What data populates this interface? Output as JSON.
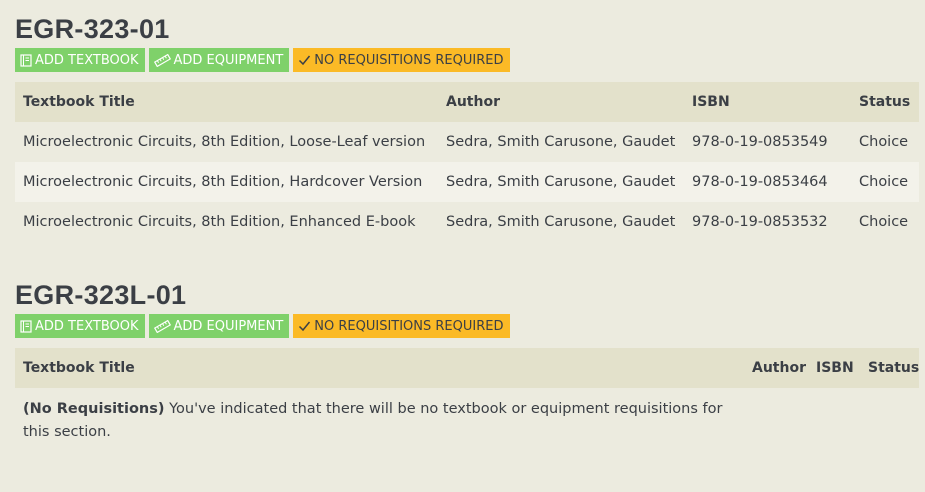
{
  "sections": [
    {
      "title": "EGR-323-01",
      "buttons": {
        "add_textbook": "ADD TEXTBOOK",
        "add_equipment": "ADD EQUIPMENT",
        "no_requisitions": "NO REQUISITIONS REQUIRED"
      },
      "table": {
        "headers": [
          "Textbook Title",
          "Author",
          "ISBN",
          "Status"
        ],
        "rows": [
          [
            "Microelectronic Circuits, 8th Edition, Loose-Leaf version",
            "Sedra, Smith Carusone, Gaudet",
            "978-0-19-0853549",
            "Choice"
          ],
          [
            "Microelectronic Circuits, 8th Edition, Hardcover Version",
            "Sedra, Smith Carusone, Gaudet",
            "978-0-19-0853464",
            "Choice"
          ],
          [
            "Microelectronic Circuits, 8th Edition, Enhanced E-book",
            "Sedra, Smith Carusone, Gaudet",
            "978-0-19-0853532",
            "Choice"
          ]
        ]
      }
    },
    {
      "title": "EGR-323L-01",
      "buttons": {
        "add_textbook": "ADD TEXTBOOK",
        "add_equipment": "ADD EQUIPMENT",
        "no_requisitions": "NO REQUISITIONS REQUIRED"
      },
      "table": {
        "headers": [
          "Textbook Title",
          "Author",
          "ISBN",
          "Status"
        ],
        "note_bold": "(No Requisitions)",
        "note_text": " You've indicated that there will be no textbook or equipment requisitions for this section."
      }
    }
  ],
  "colors": {
    "background": "#ecebdf",
    "header_bg": "#e3e1cb",
    "green_button": "#7fd16a",
    "yellow_button": "#fbba26",
    "text": "#3b3f45"
  },
  "icons": {
    "add_textbook": "book-icon",
    "add_equipment": "ruler-icon",
    "no_requisitions": "check-icon"
  }
}
